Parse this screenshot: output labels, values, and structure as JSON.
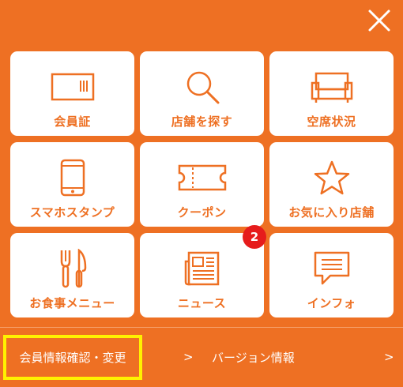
{
  "menu": {
    "tiles": [
      {
        "label": "会員証",
        "icon": "member-card-icon"
      },
      {
        "label": "店舗を探す",
        "icon": "search-icon"
      },
      {
        "label": "空席状況",
        "icon": "sofa-icon"
      },
      {
        "label": "スマホスタンプ",
        "icon": "smartphone-icon"
      },
      {
        "label": "クーポン",
        "icon": "ticket-icon"
      },
      {
        "label": "お気に入り店舗",
        "icon": "star-icon"
      },
      {
        "label": "お食事メニュー",
        "icon": "fork-knife-icon"
      },
      {
        "label": "ニュース",
        "icon": "newspaper-icon",
        "badge": "2"
      },
      {
        "label": "インフォ",
        "icon": "speech-bubble-icon"
      }
    ]
  },
  "footer": {
    "member_link": "会員情報確認・変更",
    "member_chevron": ">",
    "version_link": "バージョン情報",
    "version_chevron": ">"
  },
  "colors": {
    "accent": "#EE7023",
    "badge": "#E61C1C",
    "highlight": "#FFF200"
  }
}
